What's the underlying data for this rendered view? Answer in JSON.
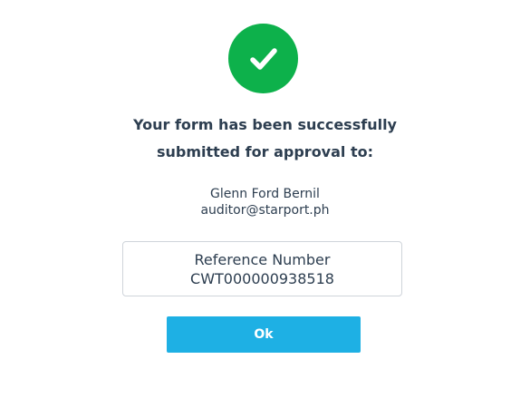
{
  "status": {
    "icon": "check-icon",
    "color": "#0db14b"
  },
  "message": {
    "line1": "Your form has been successfully",
    "line2": "submitted for approval to:"
  },
  "recipient": {
    "name": "Glenn Ford Bernil",
    "email": "auditor@starport.ph"
  },
  "reference": {
    "label": "Reference Number",
    "number": "CWT000000938518"
  },
  "actions": {
    "ok_label": "Ok",
    "ok_color": "#1eb0e4"
  }
}
